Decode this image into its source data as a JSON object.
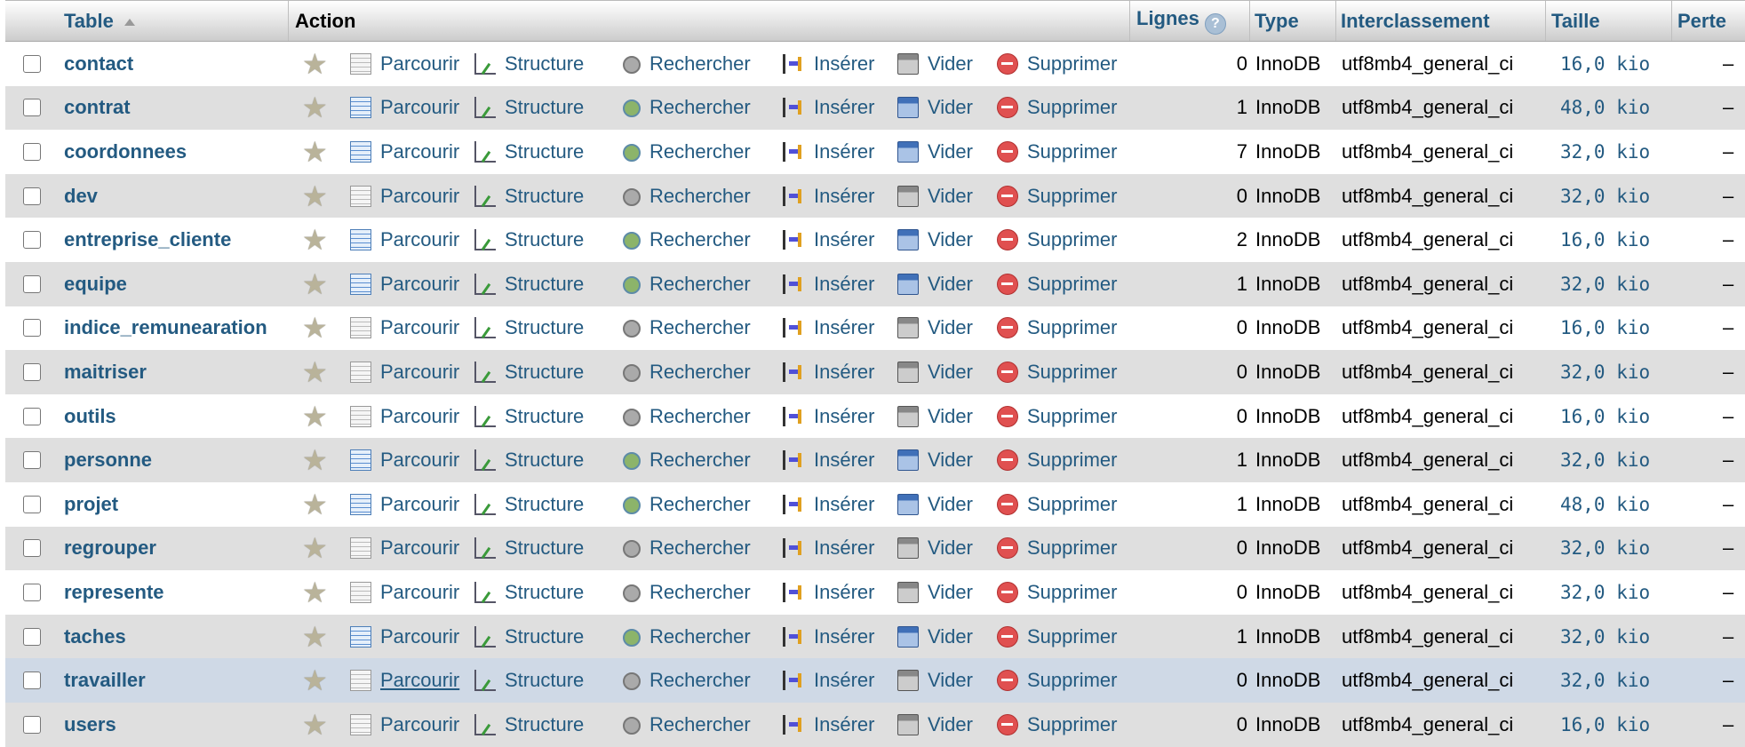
{
  "header": {
    "table": "Table",
    "action": "Action",
    "lignes": "Lignes",
    "type": "Type",
    "interclassement": "Interclassement",
    "taille": "Taille",
    "perte": "Perte"
  },
  "actions": {
    "parcourir": "Parcourir",
    "structure": "Structure",
    "rechercher": "Rechercher",
    "inserer": "Insérer",
    "vider": "Vider",
    "supprimer": "Supprimer"
  },
  "rows": [
    {
      "name": "contact",
      "lignes": "0",
      "type": "InnoDB",
      "inter": "utf8mb4_general_ci",
      "taille": "16,0 kio",
      "perte": "–"
    },
    {
      "name": "contrat",
      "lignes": "1",
      "type": "InnoDB",
      "inter": "utf8mb4_general_ci",
      "taille": "48,0 kio",
      "perte": "–"
    },
    {
      "name": "coordonnees",
      "lignes": "7",
      "type": "InnoDB",
      "inter": "utf8mb4_general_ci",
      "taille": "32,0 kio",
      "perte": "–"
    },
    {
      "name": "dev",
      "lignes": "0",
      "type": "InnoDB",
      "inter": "utf8mb4_general_ci",
      "taille": "32,0 kio",
      "perte": "–"
    },
    {
      "name": "entreprise_cliente",
      "lignes": "2",
      "type": "InnoDB",
      "inter": "utf8mb4_general_ci",
      "taille": "16,0 kio",
      "perte": "–"
    },
    {
      "name": "equipe",
      "lignes": "1",
      "type": "InnoDB",
      "inter": "utf8mb4_general_ci",
      "taille": "32,0 kio",
      "perte": "–"
    },
    {
      "name": "indice_remunearation",
      "lignes": "0",
      "type": "InnoDB",
      "inter": "utf8mb4_general_ci",
      "taille": "16,0 kio",
      "perte": "–"
    },
    {
      "name": "maitriser",
      "lignes": "0",
      "type": "InnoDB",
      "inter": "utf8mb4_general_ci",
      "taille": "32,0 kio",
      "perte": "–"
    },
    {
      "name": "outils",
      "lignes": "0",
      "type": "InnoDB",
      "inter": "utf8mb4_general_ci",
      "taille": "16,0 kio",
      "perte": "–"
    },
    {
      "name": "personne",
      "lignes": "1",
      "type": "InnoDB",
      "inter": "utf8mb4_general_ci",
      "taille": "32,0 kio",
      "perte": "–"
    },
    {
      "name": "projet",
      "lignes": "1",
      "type": "InnoDB",
      "inter": "utf8mb4_general_ci",
      "taille": "48,0 kio",
      "perte": "–"
    },
    {
      "name": "regrouper",
      "lignes": "0",
      "type": "InnoDB",
      "inter": "utf8mb4_general_ci",
      "taille": "32,0 kio",
      "perte": "–"
    },
    {
      "name": "represente",
      "lignes": "0",
      "type": "InnoDB",
      "inter": "utf8mb4_general_ci",
      "taille": "32,0 kio",
      "perte": "–"
    },
    {
      "name": "taches",
      "lignes": "1",
      "type": "InnoDB",
      "inter": "utf8mb4_general_ci",
      "taille": "32,0 kio",
      "perte": "–"
    },
    {
      "name": "travailler",
      "lignes": "0",
      "type": "InnoDB",
      "inter": "utf8mb4_general_ci",
      "taille": "32,0 kio",
      "perte": "–"
    },
    {
      "name": "users",
      "lignes": "0",
      "type": "InnoDB",
      "inter": "utf8mb4_general_ci",
      "taille": "16,0 kio",
      "perte": "–"
    }
  ]
}
